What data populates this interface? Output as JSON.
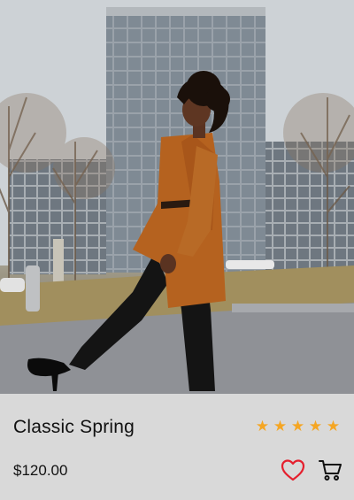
{
  "product": {
    "title": "Classic Spring",
    "price": "$120.00",
    "rating": 5,
    "rating_max": 5,
    "image_alt": "Woman in a caramel coat and black trousers posing in front of a glass office building"
  },
  "icons": {
    "favorite": "heart-outline-icon",
    "cart": "shopping-cart-icon",
    "star": "star-icon"
  },
  "colors": {
    "background": "#d9d9d9",
    "star": "#f5a623",
    "heart": "#e5202e",
    "text": "#111111"
  }
}
